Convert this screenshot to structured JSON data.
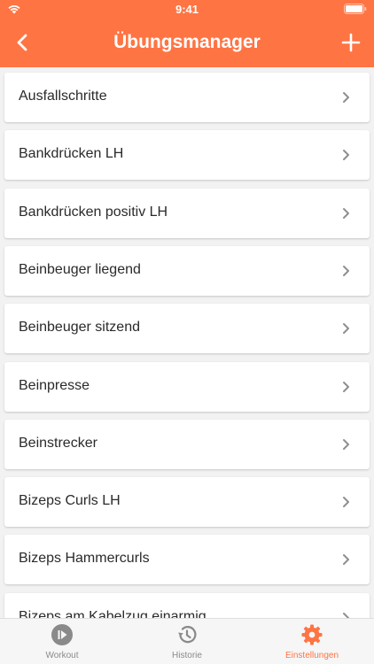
{
  "status_bar": {
    "time": "9:41"
  },
  "nav": {
    "title": "Übungsmanager",
    "back_icon": "chevron-left-icon",
    "add_icon": "plus-icon"
  },
  "exercises": [
    {
      "label": "Ausfallschritte"
    },
    {
      "label": "Bankdrücken LH"
    },
    {
      "label": "Bankdrücken positiv LH"
    },
    {
      "label": "Beinbeuger liegend"
    },
    {
      "label": "Beinbeuger sitzend"
    },
    {
      "label": "Beinpresse"
    },
    {
      "label": "Beinstrecker"
    },
    {
      "label": "Bizeps Curls LH"
    },
    {
      "label": "Bizeps Hammercurls"
    },
    {
      "label": "Bizeps am Kabelzug einarmig"
    }
  ],
  "tabs": [
    {
      "label": "Workout",
      "icon": "play-circle-icon",
      "active": false
    },
    {
      "label": "Historie",
      "icon": "history-icon",
      "active": false
    },
    {
      "label": "Einstellungen",
      "icon": "gear-icon",
      "active": true
    }
  ],
  "colors": {
    "accent": "#ff7443",
    "inactive": "#8a8a8a",
    "chevron": "#8e8e93"
  }
}
